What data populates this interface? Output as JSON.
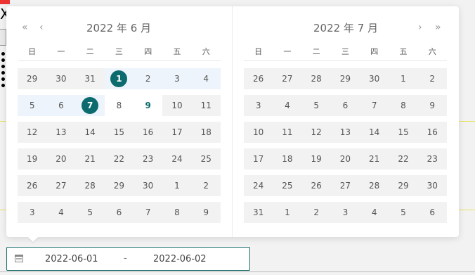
{
  "background": {
    "partial_text": "X"
  },
  "picker": {
    "left": {
      "title": "2022 年 6 月",
      "prev_year": "«",
      "prev_month": "‹",
      "weekdays": [
        "日",
        "一",
        "二",
        "三",
        "四",
        "五",
        "六"
      ],
      "weeks": [
        [
          "29",
          "30",
          "31",
          "1",
          "2",
          "3",
          "4"
        ],
        [
          "5",
          "6",
          "7",
          "8",
          "9",
          "10",
          "11"
        ],
        [
          "12",
          "13",
          "14",
          "15",
          "16",
          "17",
          "18"
        ],
        [
          "19",
          "20",
          "21",
          "22",
          "23",
          "24",
          "25"
        ],
        [
          "26",
          "27",
          "28",
          "29",
          "30",
          "1",
          "2"
        ],
        [
          "3",
          "4",
          "5",
          "6",
          "7",
          "8",
          "9"
        ]
      ]
    },
    "right": {
      "title": "2022 年 7 月",
      "next_month": "›",
      "next_year": "»",
      "weekdays": [
        "日",
        "一",
        "二",
        "三",
        "四",
        "五",
        "六"
      ],
      "weeks": [
        [
          "26",
          "27",
          "28",
          "29",
          "30",
          "1",
          "2"
        ],
        [
          "3",
          "4",
          "5",
          "6",
          "7",
          "8",
          "9"
        ],
        [
          "10",
          "11",
          "12",
          "13",
          "14",
          "15",
          "16"
        ],
        [
          "17",
          "18",
          "19",
          "20",
          "21",
          "22",
          "23"
        ],
        [
          "24",
          "25",
          "26",
          "27",
          "28",
          "29",
          "30"
        ],
        [
          "31",
          "1",
          "2",
          "3",
          "4",
          "5",
          "6"
        ]
      ]
    },
    "selected_days": [
      "2022-06-01",
      "2022-06-07"
    ],
    "today": "2022-06-09",
    "accent_color": "#0c6b6e"
  },
  "input": {
    "start": "2022-06-01",
    "separator": "-",
    "end": "2022-06-02",
    "icon": "calendar-icon"
  }
}
